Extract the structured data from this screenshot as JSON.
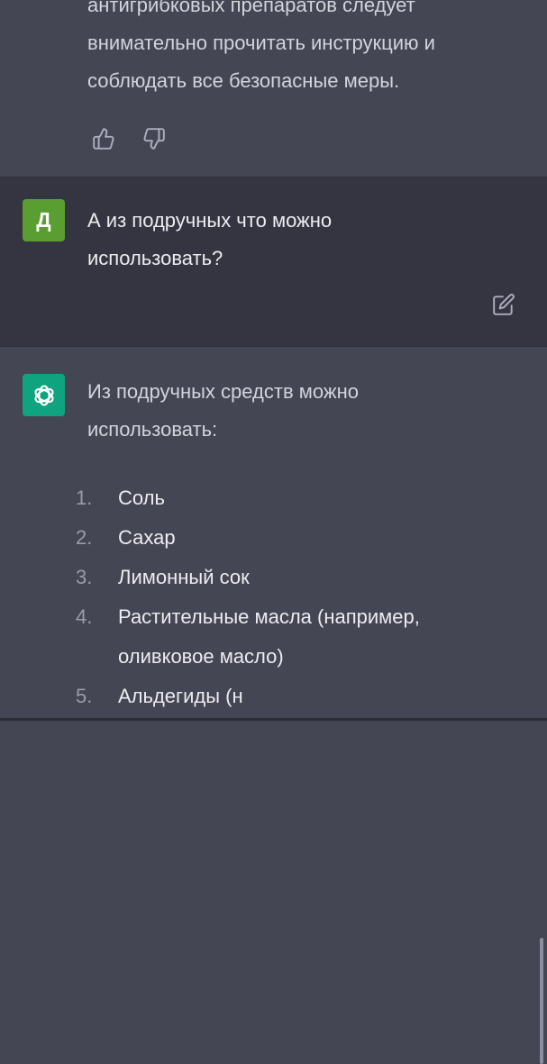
{
  "previous_answer": {
    "text": "антигрибковых препаратов следует\nвнимательно прочитать инструкцию и\nсоблюдать все безопасные меры.",
    "thumbs_up_icon": "thumbs-up-icon",
    "thumbs_down_icon": "thumbs-down-icon"
  },
  "user_message": {
    "avatar_letter": "Д",
    "text": "А из подручных что можно\nиспользовать?",
    "edit_icon": "edit-icon"
  },
  "assistant_message": {
    "avatar_icon": "chatgpt-logo-icon",
    "intro": "Из подручных средств можно\nиспользовать:",
    "items": [
      {
        "number": "1.",
        "text": "Соль"
      },
      {
        "number": "2.",
        "text": "Сахар"
      },
      {
        "number": "3.",
        "text": "Лимонный сок"
      },
      {
        "number": "4.",
        "text": "Растительные масла (например,\nоливковое масло)"
      },
      {
        "number": "5.",
        "text": "Альдегиды (н"
      }
    ]
  },
  "colors": {
    "assistant_bg": "#444654",
    "user_bg": "#343541",
    "user_avatar": "#5a9e32",
    "assistant_avatar": "#10a37f"
  }
}
